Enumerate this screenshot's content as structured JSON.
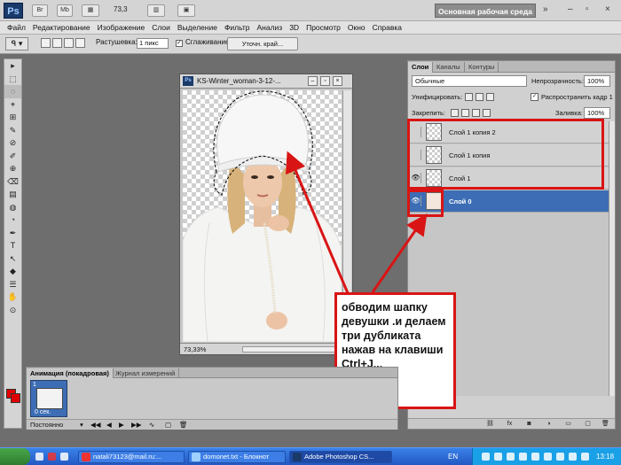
{
  "appbar": {
    "logo": "Ps",
    "btn_br": "Br",
    "btn_mb": "Mb",
    "zoom": "73,3",
    "workspace": "Основная рабочая среда",
    "expand": "»",
    "minimize": "–",
    "restore": "▫",
    "close": "×"
  },
  "menu": [
    "Файл",
    "Редактирование",
    "Изображение",
    "Слои",
    "Выделение",
    "Фильтр",
    "Анализ",
    "3D",
    "Просмотр",
    "Окно",
    "Справка"
  ],
  "options": {
    "feather_label": "Растушевка:",
    "feather_value": "1 пикс",
    "antialias_label": "Сглаживание",
    "antialias_checked": "✓",
    "refine_button": "Уточн. край..."
  },
  "tools": [
    "▸",
    "⬚",
    "◌",
    "⌖",
    "⊞",
    "✎",
    "⊘",
    "✐",
    "⊕",
    "⌫",
    "▤",
    "◍",
    "◔",
    "✒",
    "T",
    "↖",
    "◆",
    "☰",
    "✋",
    "⊙"
  ],
  "document": {
    "icon": "Ps",
    "title": "KS-Winter_woman-3-12-...",
    "zoom": "73,33%"
  },
  "layers_panel": {
    "tabs": [
      "Слои",
      "Каналы",
      "Контуры"
    ],
    "blend_mode": "Обычные",
    "opacity_label": "Непрозрачность:",
    "opacity_value": "100%",
    "unify_label": "Унифицировать:",
    "propagate_label": "Распространить кадр 1",
    "lock_label": "Закрепить:",
    "fill_label": "Заливка:",
    "fill_value": "100%",
    "layers": [
      {
        "name": "Слой 1 копия 2",
        "visible": false,
        "active": false
      },
      {
        "name": "Слой 1 копия",
        "visible": false,
        "active": false
      },
      {
        "name": "Слой 1",
        "visible": true,
        "active": false
      },
      {
        "name": "Слой 0",
        "visible": true,
        "active": true
      }
    ],
    "eye_icon": "👁"
  },
  "annotation": {
    "lines": [
      "обводим шапку",
      "девушки .и делаем",
      "три дубликата",
      "нажав на клавиши",
      "Ctrl+J..."
    ]
  },
  "animation_panel": {
    "tabs": [
      "Анимация (покадровая)",
      "Журнал измерений"
    ],
    "frame_number": "1",
    "frame_time": "0 сек.",
    "loop": "Постоянно"
  },
  "taskbar": {
    "items": [
      "natali73123@mail.ru:...",
      "domonet.txt - Блокнот",
      "Adobe Photoshop CS..."
    ],
    "language": "EN",
    "clock": "13:18"
  },
  "colors": {
    "highlight_red": "#d91414",
    "active_layer_blue": "#3d6eb5",
    "foreground_color": "#e00000"
  }
}
